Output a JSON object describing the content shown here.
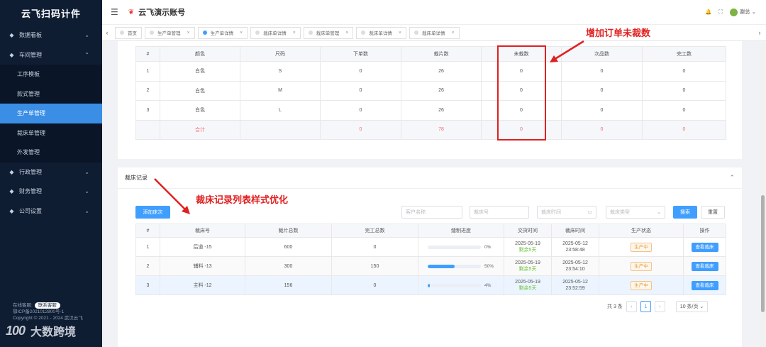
{
  "sidebar": {
    "logo": "云飞扫码计件",
    "menu": [
      {
        "label": "数据看板",
        "icon": "dashboard-icon"
      },
      {
        "label": "车间管理",
        "icon": "workshop-icon",
        "expanded": true,
        "children": [
          "工序模板",
          "款式管理",
          "生产单管理",
          "裁床单管理",
          "外发管理"
        ]
      },
      {
        "label": "行政管理",
        "icon": "admin-icon"
      },
      {
        "label": "财务管理",
        "icon": "finance-icon"
      },
      {
        "label": "公司设置",
        "icon": "settings-icon"
      }
    ],
    "active_child": "生产单管理",
    "footer": {
      "online": "在线客服:",
      "contact": "联系客服",
      "icp": "鄂ICP备2021012800号-1",
      "copyright": "Copyright © 2021 - 2024 武汉云飞"
    },
    "watermark": "大数跨境",
    "watermark_logo": "100"
  },
  "header": {
    "brand": "云飞演示账号",
    "user": "谢总"
  },
  "tabs": [
    {
      "label": "首页",
      "closable": false,
      "active": false
    },
    {
      "label": "生产单管理",
      "closable": true,
      "active": false
    },
    {
      "label": "生产单详情",
      "closable": true,
      "active": true
    },
    {
      "label": "裁床单详情",
      "closable": true,
      "active": false
    },
    {
      "label": "裁床单管理",
      "closable": true,
      "active": false
    },
    {
      "label": "裁床单详情",
      "closable": true,
      "active": false
    },
    {
      "label": "裁床单详情",
      "closable": true,
      "active": false
    }
  ],
  "size_table": {
    "columns": [
      "#",
      "颜色",
      "尺码",
      "下单数",
      "裁片数",
      "未裁数",
      "次品数",
      "完工数"
    ],
    "rows": [
      [
        "1",
        "白色",
        "S",
        "0",
        "26",
        "0",
        "0",
        "0"
      ],
      [
        "2",
        "白色",
        "M",
        "0",
        "26",
        "0",
        "0",
        "0"
      ],
      [
        "3",
        "白色",
        "L",
        "0",
        "26",
        "0",
        "0",
        "0"
      ]
    ],
    "total": [
      "",
      "合计",
      "",
      "0",
      "78",
      "0",
      "0",
      "0"
    ]
  },
  "annotations": {
    "top": "增加订单未裁数",
    "bottom": "裁床记录列表样式优化"
  },
  "cutting_section": {
    "title": "裁床记录",
    "add_button": "添加床次",
    "filters": {
      "customer_placeholder": "客户名称",
      "bed_no_placeholder": "裁床号",
      "time_placeholder": "裁床时间",
      "type_placeholder": "裁床类型"
    },
    "search_button": "搜索",
    "reset_button": "重置",
    "columns": [
      "#",
      "裁床号",
      "裁片总数",
      "完工总数",
      "缝制进度",
      "交货时间",
      "裁床时间",
      "生产状态",
      "操作"
    ],
    "rows": [
      {
        "no": "1",
        "bed": "后道 -15",
        "pieces": "600",
        "done": "0",
        "progress": 0,
        "progress_label": "0%",
        "delivery": "2025-05-19",
        "remain": "剩余5天",
        "cut_date": "2025-05-12",
        "cut_time": "23:58:48",
        "status": "生产中",
        "action": "查看裁床"
      },
      {
        "no": "2",
        "bed": "辅料 -13",
        "pieces": "300",
        "done": "150",
        "progress": 50,
        "progress_label": "50%",
        "delivery": "2025-05-19",
        "remain": "剩余5天",
        "cut_date": "2025-05-12",
        "cut_time": "23:54:10",
        "status": "生产中",
        "action": "查看裁床"
      },
      {
        "no": "3",
        "bed": "主料 -12",
        "pieces": "156",
        "done": "0",
        "progress": 4,
        "progress_label": "4%",
        "delivery": "2025-05-19",
        "remain": "剩余5天",
        "cut_date": "2025-05-12",
        "cut_time": "23:52:59",
        "status": "生产中",
        "action": "查看裁床"
      }
    ],
    "pagination": {
      "total": "共 3 条",
      "current": "1",
      "size": "10 条/页"
    }
  },
  "colors": {
    "accent": "#409eff",
    "sidebar": "#0f1d33",
    "annotation": "#e02020",
    "status": "#e6a23c"
  }
}
